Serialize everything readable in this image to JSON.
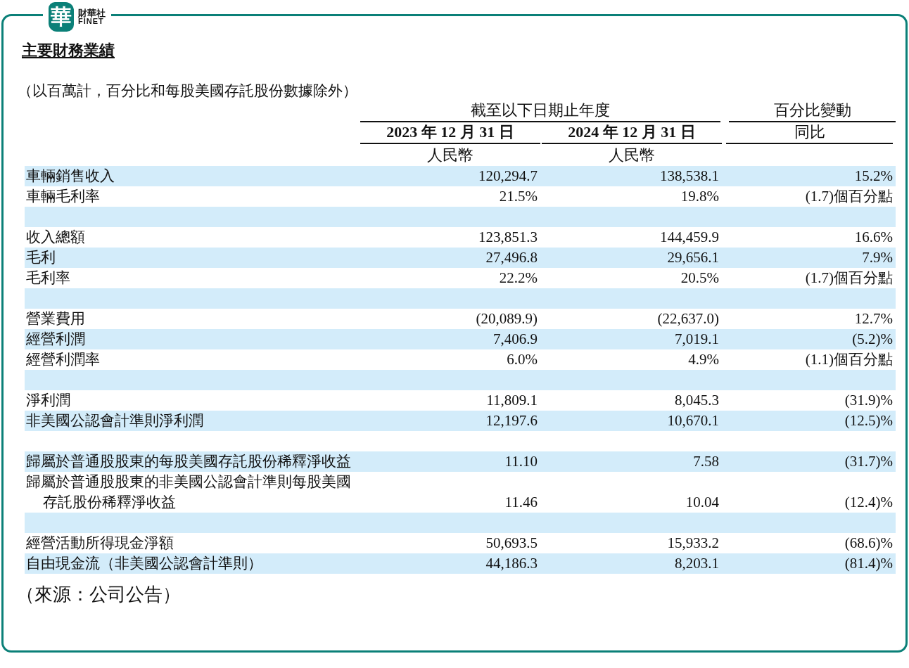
{
  "logo": {
    "mark": "華",
    "name": "財華社",
    "latin": "FINET"
  },
  "title": "主要財務業績",
  "note": "（以百萬計，百分比和每股美國存託股份數據除外）",
  "header": {
    "group": "截至以下日期止年度",
    "change": "百分比變動",
    "periods": [
      "2023 年 12 月 31 日",
      "2024 年 12 月 31 日"
    ],
    "change_sub": "同比",
    "currency": [
      "人民幣",
      "人民幣"
    ]
  },
  "rows": [
    {
      "kind": "data",
      "label": "車輛銷售收入",
      "values": [
        "120,294.7",
        "138,538.1",
        "15.2%"
      ]
    },
    {
      "kind": "data",
      "label": "車輛毛利率",
      "values": [
        "21.5%",
        "19.8%",
        "(1.7)個百分點"
      ]
    },
    {
      "kind": "spacer"
    },
    {
      "kind": "data",
      "label": "收入總額",
      "values": [
        "123,851.3",
        "144,459.9",
        "16.6%"
      ]
    },
    {
      "kind": "data",
      "label": "毛利",
      "values": [
        "27,496.8",
        "29,656.1",
        "7.9%"
      ]
    },
    {
      "kind": "data",
      "label": "毛利率",
      "values": [
        "22.2%",
        "20.5%",
        "(1.7)個百分點"
      ]
    },
    {
      "kind": "spacer"
    },
    {
      "kind": "data",
      "label": "營業費用",
      "values": [
        "(20,089.9)",
        "(22,637.0)",
        "12.7%"
      ]
    },
    {
      "kind": "data",
      "label": "經營利潤",
      "values": [
        "7,406.9",
        "7,019.1",
        "(5.2)%"
      ]
    },
    {
      "kind": "data",
      "label": "經營利潤率",
      "values": [
        "6.0%",
        "4.9%",
        "(1.1)個百分點"
      ]
    },
    {
      "kind": "spacer"
    },
    {
      "kind": "data",
      "label": "淨利潤",
      "values": [
        "11,809.1",
        "8,045.3",
        "(31.9)%"
      ]
    },
    {
      "kind": "data",
      "label": "非美國公認會計準則淨利潤",
      "values": [
        "12,197.6",
        "10,670.1",
        "(12.5)%"
      ]
    },
    {
      "kind": "spacer"
    },
    {
      "kind": "data",
      "label": "歸屬於普通股股東的每股美國存託股份稀釋淨收益",
      "values": [
        "11.10",
        "7.58",
        "(31.7)%"
      ]
    },
    {
      "kind": "data",
      "label": "歸屬於普通股股東的非美國公認會計準則每股美國存託股份稀釋淨收益",
      "values": [
        "11.46",
        "10.04",
        "(12.4)%"
      ]
    },
    {
      "kind": "spacer"
    },
    {
      "kind": "data",
      "label": "經營活動所得現金淨額",
      "values": [
        "50,693.5",
        "15,933.2",
        "(68.6)%"
      ]
    },
    {
      "kind": "data",
      "label": "自由現金流（非美國公認會計準則）",
      "values": [
        "44,186.3",
        "8,203.1",
        "(81.4)%"
      ]
    }
  ],
  "source": "（來源：公司公告）"
}
